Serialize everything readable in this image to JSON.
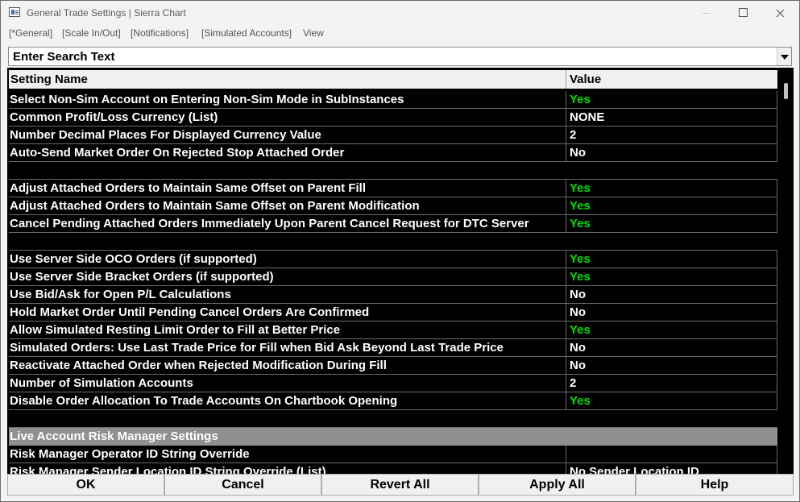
{
  "window": {
    "title": "General Trade Settings | Sierra Chart"
  },
  "menu": [
    "[*General]",
    "[Scale In/Out]",
    "[Notifications]",
    "[Simulated Accounts]",
    "View"
  ],
  "search": {
    "text": "Enter Search Text"
  },
  "table": {
    "headers": {
      "name": "Setting Name",
      "value": "Value"
    },
    "rows": [
      {
        "name": "Select Non-Sim Account on Entering Non-Sim Mode in SubInstances",
        "value": "Yes"
      },
      {
        "name": "Common Profit/Loss Currency (List)",
        "value": "NONE"
      },
      {
        "name": "Number Decimal Places For Displayed Currency Value",
        "value": "2"
      },
      {
        "name": "Auto-Send Market Order On Rejected Stop Attached Order",
        "value": "No"
      },
      {
        "name": "",
        "value": ""
      },
      {
        "name": "Adjust Attached Orders to Maintain Same Offset on Parent Fill",
        "value": "Yes"
      },
      {
        "name": "Adjust Attached Orders to Maintain Same Offset on Parent Modification",
        "value": "Yes"
      },
      {
        "name": "Cancel Pending Attached Orders Immediately Upon Parent Cancel Request for DTC Server",
        "value": "Yes"
      },
      {
        "name": "",
        "value": ""
      },
      {
        "name": "Use Server Side OCO Orders (if supported)",
        "value": "Yes"
      },
      {
        "name": "Use Server Side Bracket Orders (if supported)",
        "value": "Yes"
      },
      {
        "name": "Use Bid/Ask for Open P/L Calculations",
        "value": "No"
      },
      {
        "name": "Hold Market Order Until Pending Cancel Orders Are Confirmed",
        "value": "No"
      },
      {
        "name": "Allow Simulated Resting Limit Order to Fill at Better Price",
        "value": "Yes"
      },
      {
        "name": "Simulated Orders: Use Last Trade Price for Fill when Bid Ask Beyond Last Trade Price",
        "value": "No"
      },
      {
        "name": "Reactivate Attached Order when Rejected Modification During Fill",
        "value": "No"
      },
      {
        "name": "Number of Simulation Accounts",
        "value": "2"
      },
      {
        "name": "Disable Order Allocation To Trade Accounts On Chartbook Opening",
        "value": "Yes"
      },
      {
        "name": "",
        "value": ""
      },
      {
        "name": "Live Account Risk Manager Settings",
        "value": "",
        "section": true
      },
      {
        "name": "Risk Manager Operator ID String Override",
        "value": ""
      },
      {
        "name": "Risk Manager Sender Location ID String Override (List)",
        "value": "No Sender Location ID"
      }
    ]
  },
  "buttons": [
    "OK",
    "Cancel",
    "Revert All",
    "Apply All",
    "Help"
  ],
  "colors": {
    "grid_bg": "#000000",
    "text": "#ffffff",
    "yes": "#00e000",
    "section": "#909090"
  }
}
